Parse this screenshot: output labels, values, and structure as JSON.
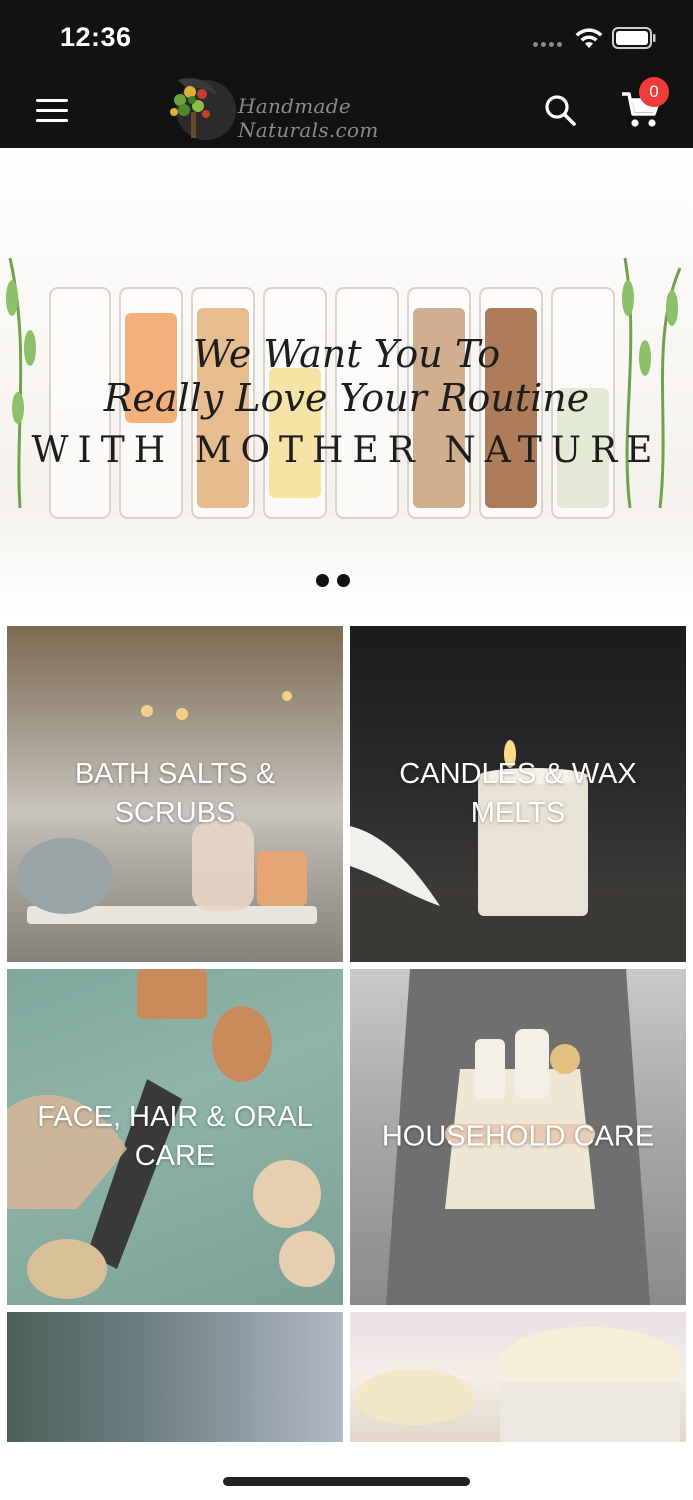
{
  "status_bar": {
    "time": "12:36"
  },
  "header": {
    "logo_text": "Handmade Naturals.com",
    "cart_count": "0",
    "icons": [
      "menu-icon",
      "search-icon",
      "cart-icon"
    ]
  },
  "banner": {
    "line1": "We Want You To",
    "line2": "Really Love Your Routine",
    "line3": "WITH MOTHER NATURE",
    "slide_count": 2
  },
  "categories": [
    {
      "label": "BATH SALTS & SCRUBS"
    },
    {
      "label": "CANDLES & WAX MELTS"
    },
    {
      "label": "FACE, HAIR & ORAL CARE"
    },
    {
      "label": "HOUSEHOLD CARE"
    },
    {
      "label": ""
    },
    {
      "label": ""
    }
  ],
  "colors": {
    "header_bg": "#121212",
    "badge": "#ef3b3b"
  }
}
